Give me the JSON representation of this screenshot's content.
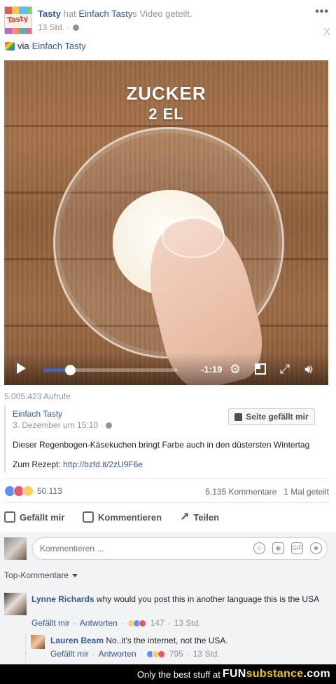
{
  "post": {
    "page_name": "Tasty",
    "shared_text_1": "hat",
    "source_name": "Einfach Tasty",
    "shared_text_2": "s Video geteilt.",
    "time": "13 Std.",
    "via_label": "via",
    "via_name": "Einfach Tasty",
    "menu_icon": "more-dots-icon",
    "close_label": "X"
  },
  "video": {
    "overlay_title": "ZUCKER",
    "overlay_subtitle": "2 EL",
    "time_remaining": "-1:19",
    "progress": 0.2
  },
  "shared_post": {
    "views": "5.005.423 Aufrufe",
    "name": "Einfach Tasty",
    "date": "3. Dezember um 15:10 ·",
    "like_page_label": "Seite gefällt mir",
    "description": "Dieser Regenbogen-Käsekuchen bringt Farbe auch in den düstersten Wintertag",
    "recipe_label": "Zum Rezept:",
    "recipe_link": "http://bzfd.it/2zU9F6e"
  },
  "stats": {
    "reaction_count": "50.113",
    "comments": "5.135 Kommentare",
    "shares": "1 Mal geteilt"
  },
  "actions": {
    "like": "Gefällt mir",
    "comment": "Kommentieren",
    "share": "Teilen"
  },
  "composer": {
    "placeholder": "Kommentieren ..."
  },
  "comments_header": "Top-Kommentare",
  "comments": [
    {
      "name": "Lynne Richards",
      "text": "why would you post this in another language this is the USA",
      "like": "Gefällt mir",
      "reply": "Antworten",
      "reactions": "147",
      "time": "13 Std."
    },
    {
      "name": "Lauren Beam",
      "text": "No..it's the internet, not the USA.",
      "like": "Gefällt mir",
      "reply": "Antworten",
      "reactions": "795",
      "time": "13 Std."
    }
  ],
  "footer": {
    "text": "Only the best stuff at",
    "brand_a": "FUN",
    "brand_b": "substance",
    "brand_c": ".com"
  },
  "colors": {
    "link": "#365899",
    "accent": "#4267b2"
  }
}
